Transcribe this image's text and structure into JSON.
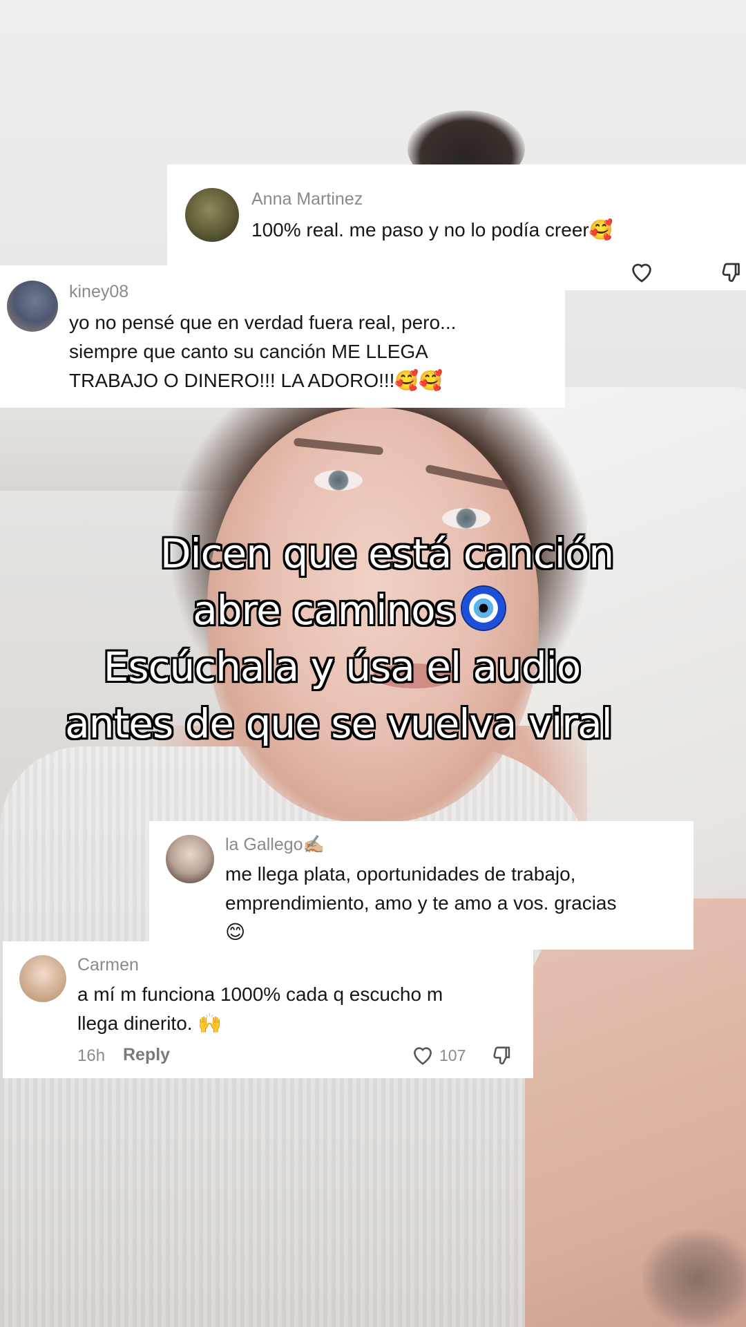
{
  "comments": [
    {
      "username": "Anna Martinez",
      "text": "100% real. me paso y no lo podía creer🥰"
    },
    {
      "username": "kiney08",
      "text": "yo no pensé que en verdad fuera real, pero...\nsiempre que canto su canción ME LLEGA\nTRABAJO O DINERO!!! LA ADORO!!!🥰🥰"
    },
    {
      "username": "la Gallego✍🏼",
      "text": "me llega plata, oportunidades de trabajo,\nemprendimiento, amo y te amo a vos. gracias\n😊"
    },
    {
      "username": "Carmen",
      "text": "a mí m funciona 1000% cada q escucho m\nllega dinerito. 🙌",
      "time": "16h",
      "reply_label": "Reply",
      "likes": "107"
    }
  ],
  "caption": {
    "line1": "Dicen que está canción",
    "line2": "abre caminos",
    "line3": "Escúchala y úsa el audio",
    "line4": "antes de que se vuelva viral",
    "emoji_icon": "nazar-evil-eye-icon"
  },
  "colors": {
    "card_bg": "#ffffff",
    "username": "#8a8a8a",
    "comment_text": "#161616",
    "caption_text": "#ffffff",
    "caption_outline": "#000000"
  }
}
